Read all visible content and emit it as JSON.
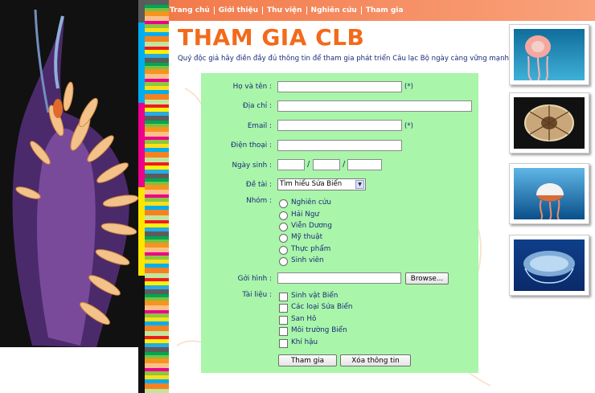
{
  "nav": {
    "items": [
      "Trang chủ",
      "Giới thiệu",
      "Thư viện",
      "Nghiên cứu",
      "Tham gia"
    ]
  },
  "page": {
    "title": "THAM GIA CLB",
    "intro": "Quý độc giả hãy điền đầy đủ thông tin để tham gia phát triển Câu lạc Bộ ngày càng vững mạnh hơn"
  },
  "form": {
    "name_label": "Họ và tên :",
    "address_label": "Địa chỉ :",
    "email_label": "Email :",
    "phone_label": "Điện thoại :",
    "dob_label": "Ngày sinh :",
    "topic_label": "Đề tài :",
    "group_label": "Nhóm :",
    "photo_label": "Gởi hình :",
    "docs_label": "Tài liệu :",
    "required_mark": "(*)",
    "date_sep": "/",
    "topic_selected": "Tìm hiểu Sứa Biển",
    "groups": [
      "Nghiên cứu",
      "Hải Ngư",
      "Viễn Dương",
      "Mỹ thuật",
      "Thực phẩm",
      "Sinh viên"
    ],
    "docs": [
      "Sinh vật Biển",
      "Các loại Sứa Biển",
      "San Hô",
      "Môi trường Biển",
      "Khí hậu"
    ],
    "browse_label": "Browse...",
    "submit_label": "Tham gia",
    "reset_label": "Xóa  thông tin"
  },
  "colors": {
    "title": "#f26a1b",
    "nav_bg": "#f27a4a",
    "form_bg": "#a9f5a9",
    "text": "#1a2a7a"
  }
}
